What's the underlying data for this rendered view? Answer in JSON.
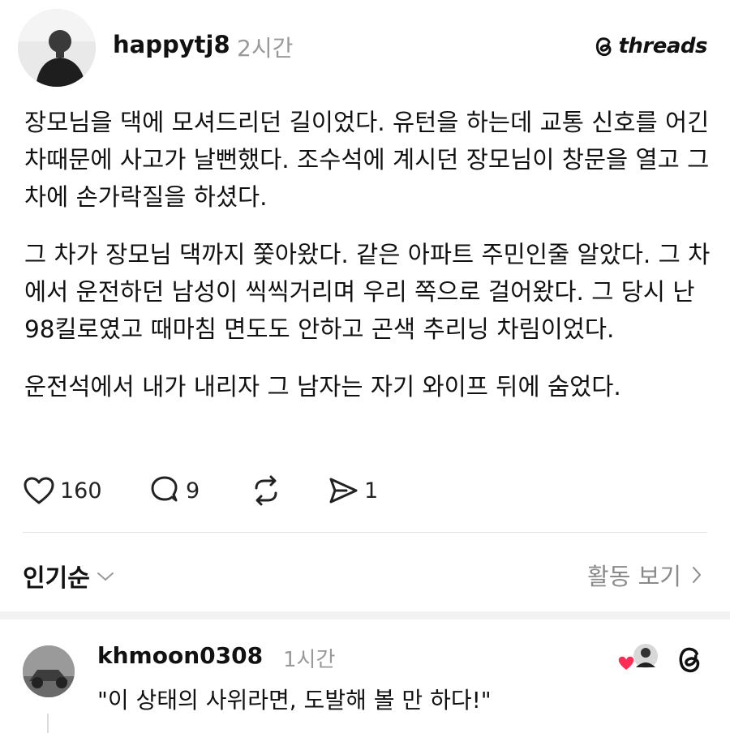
{
  "post": {
    "username": "happytj8",
    "time": "2시간",
    "brand": "threads",
    "paragraphs": [
      "장모님을 댁에 모셔드리던 길이었다. 유턴을 하는데 교통 신호를 어긴 차때문에 사고가 날뻔했다. 조수석에 계시던 장모님이 창문을 열고 그 차에 손가락질을 하셨다.",
      "그 차가 장모님 댁까지 쫓아왔다. 같은 아파트 주민인줄 알았다. 그 차에서 운전하던 남성이 씩씩거리며 우리 쪽으로 걸어왔다. 그 당시 난 98킬로였고 때마침 면도도 안하고 곤색 추리닝 차림이었다.",
      "운전석에서 내가 내리자 그 남자는 자기 와이프 뒤에 숨었다."
    ],
    "likes": "160",
    "replies": "9",
    "shares": "1"
  },
  "sort_bar": {
    "label": "인기순",
    "activity_label": "활동 보기"
  },
  "reply": {
    "username": "khmoon0308",
    "time": "1시간",
    "text": "\"이 상태의 사위라면, 도발해 볼 만 하다!\""
  },
  "icons": {
    "like": "heart-icon",
    "reply": "comment-icon",
    "repost": "repost-icon",
    "share": "send-icon",
    "sort": "chevron-down-icon",
    "activity": "chevron-right-icon",
    "brand": "threads-logo-icon"
  },
  "colors": {
    "text": "#111111",
    "muted": "#999999",
    "heart": "#ff2d55"
  }
}
